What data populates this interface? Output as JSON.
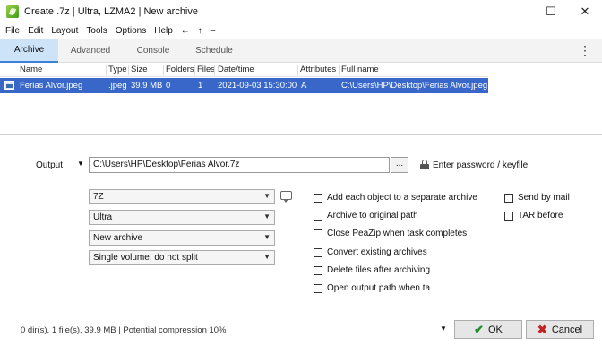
{
  "window": {
    "title": "Create .7z | Ultra, LZMA2 | New archive",
    "minimize_glyph": "—",
    "maximize_glyph": "☐",
    "close_glyph": "✕"
  },
  "menu": {
    "items": [
      "File",
      "Edit",
      "Layout",
      "Tools",
      "Options",
      "Help",
      "←",
      "↑",
      "–"
    ]
  },
  "tabs": [
    {
      "label": "Archive",
      "active": true
    },
    {
      "label": "Advanced",
      "active": false
    },
    {
      "label": "Console",
      "active": false
    },
    {
      "label": "Schedule",
      "active": false
    }
  ],
  "file_list": {
    "columns": [
      "Name",
      "Type",
      "Size",
      "Folders",
      "Files",
      "Date/time",
      "Attributes",
      "Full name"
    ],
    "rows": [
      {
        "name": "Ferias Alvor.jpeg",
        "type": ".jpeg",
        "size": "39.9 MB",
        "folders": "0",
        "files": "1",
        "datetime": "2021-09-03 15:30:00",
        "attributes": "A",
        "full_name": "C:\\Users\\HP\\Desktop\\Ferias Alvor.jpeg"
      }
    ]
  },
  "output": {
    "label": "Output",
    "path": "C:\\Users\\HP\\Desktop\\Ferias Alvor.7z",
    "browse_label": "...",
    "password_label": "Enter password / keyfile"
  },
  "options": {
    "format": "7Z",
    "level": "Ultra",
    "mode": "New archive",
    "split": "Single volume, do not split"
  },
  "checkboxes": {
    "add_separate": "Add each object to a separate archive",
    "archive_original": "Archive to original path",
    "close_peazip": "Close PeaZip when task completes",
    "convert_existing": "Convert existing archives",
    "delete_after": "Delete files after archiving",
    "open_output": "Open output path when ta",
    "send_mail": "Send by mail",
    "tar_before": "TAR before"
  },
  "status": "0 dir(s), 1 file(s), 39.9 MB | Potential compression 10%",
  "buttons": {
    "ok": "OK",
    "cancel": "Cancel"
  }
}
